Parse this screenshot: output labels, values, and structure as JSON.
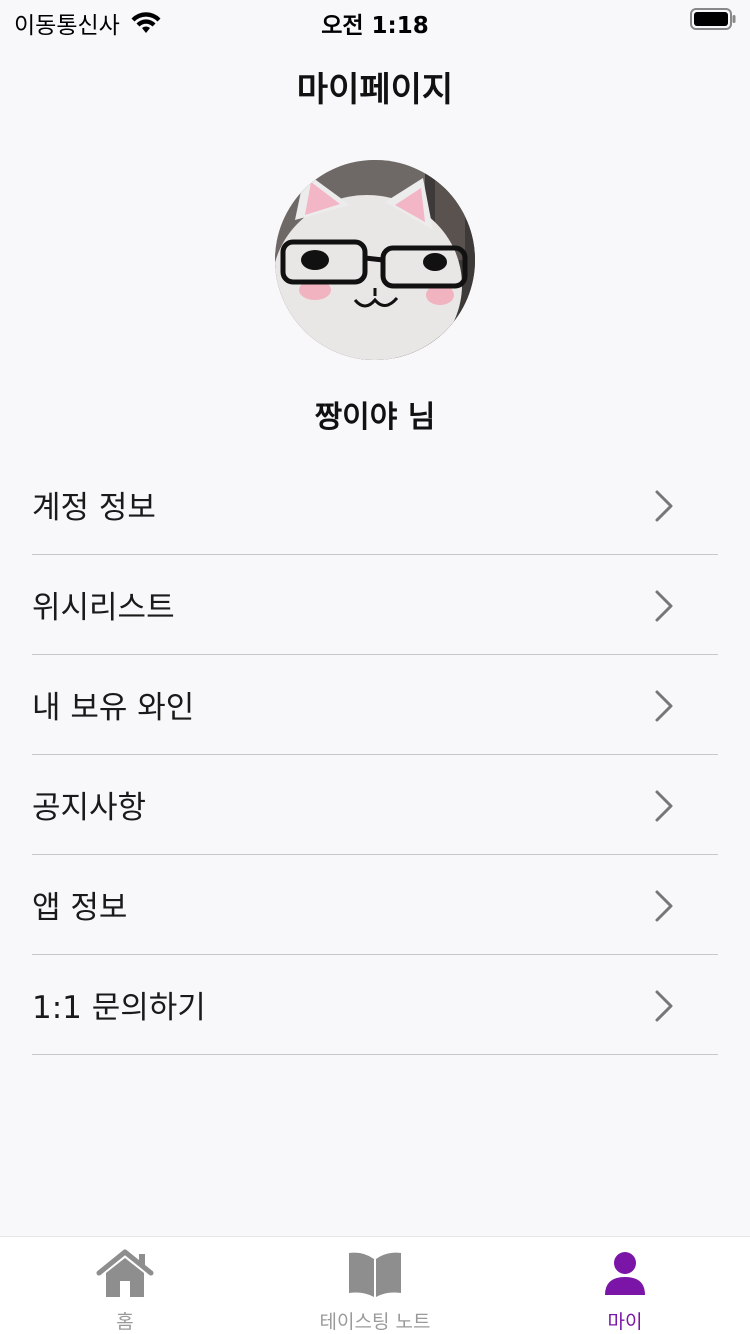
{
  "status_bar": {
    "carrier": "이동통신사",
    "time": "오전 1:18"
  },
  "header": {
    "title": "마이페이지"
  },
  "profile": {
    "name": "짱이야 님"
  },
  "menu": {
    "items": [
      {
        "label": "계정 정보"
      },
      {
        "label": "위시리스트"
      },
      {
        "label": "내 보유 와인"
      },
      {
        "label": "공지사항"
      },
      {
        "label": "앱 정보"
      },
      {
        "label": "1:1 문의하기"
      }
    ]
  },
  "tab_bar": {
    "tabs": [
      {
        "label": "홈",
        "icon": "home-icon",
        "active": false
      },
      {
        "label": "테이스팅 노트",
        "icon": "book-icon",
        "active": false
      },
      {
        "label": "마이",
        "icon": "person-icon",
        "active": true
      }
    ]
  },
  "colors": {
    "accent": "#7b15a8",
    "inactive": "#9a9a9a",
    "background": "#f8f8fa",
    "divider": "#c8c8cc"
  }
}
